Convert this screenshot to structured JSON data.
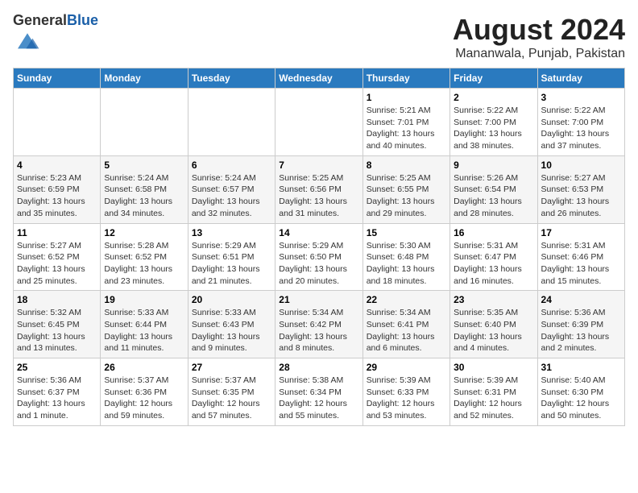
{
  "header": {
    "logo_general": "General",
    "logo_blue": "Blue",
    "month_title": "August 2024",
    "subtitle": "Mananwala, Punjab, Pakistan"
  },
  "days_of_week": [
    "Sunday",
    "Monday",
    "Tuesday",
    "Wednesday",
    "Thursday",
    "Friday",
    "Saturday"
  ],
  "weeks": [
    [
      {
        "day": "",
        "info": ""
      },
      {
        "day": "",
        "info": ""
      },
      {
        "day": "",
        "info": ""
      },
      {
        "day": "",
        "info": ""
      },
      {
        "day": "1",
        "info": "Sunrise: 5:21 AM\nSunset: 7:01 PM\nDaylight: 13 hours\nand 40 minutes."
      },
      {
        "day": "2",
        "info": "Sunrise: 5:22 AM\nSunset: 7:00 PM\nDaylight: 13 hours\nand 38 minutes."
      },
      {
        "day": "3",
        "info": "Sunrise: 5:22 AM\nSunset: 7:00 PM\nDaylight: 13 hours\nand 37 minutes."
      }
    ],
    [
      {
        "day": "4",
        "info": "Sunrise: 5:23 AM\nSunset: 6:59 PM\nDaylight: 13 hours\nand 35 minutes."
      },
      {
        "day": "5",
        "info": "Sunrise: 5:24 AM\nSunset: 6:58 PM\nDaylight: 13 hours\nand 34 minutes."
      },
      {
        "day": "6",
        "info": "Sunrise: 5:24 AM\nSunset: 6:57 PM\nDaylight: 13 hours\nand 32 minutes."
      },
      {
        "day": "7",
        "info": "Sunrise: 5:25 AM\nSunset: 6:56 PM\nDaylight: 13 hours\nand 31 minutes."
      },
      {
        "day": "8",
        "info": "Sunrise: 5:25 AM\nSunset: 6:55 PM\nDaylight: 13 hours\nand 29 minutes."
      },
      {
        "day": "9",
        "info": "Sunrise: 5:26 AM\nSunset: 6:54 PM\nDaylight: 13 hours\nand 28 minutes."
      },
      {
        "day": "10",
        "info": "Sunrise: 5:27 AM\nSunset: 6:53 PM\nDaylight: 13 hours\nand 26 minutes."
      }
    ],
    [
      {
        "day": "11",
        "info": "Sunrise: 5:27 AM\nSunset: 6:52 PM\nDaylight: 13 hours\nand 25 minutes."
      },
      {
        "day": "12",
        "info": "Sunrise: 5:28 AM\nSunset: 6:52 PM\nDaylight: 13 hours\nand 23 minutes."
      },
      {
        "day": "13",
        "info": "Sunrise: 5:29 AM\nSunset: 6:51 PM\nDaylight: 13 hours\nand 21 minutes."
      },
      {
        "day": "14",
        "info": "Sunrise: 5:29 AM\nSunset: 6:50 PM\nDaylight: 13 hours\nand 20 minutes."
      },
      {
        "day": "15",
        "info": "Sunrise: 5:30 AM\nSunset: 6:48 PM\nDaylight: 13 hours\nand 18 minutes."
      },
      {
        "day": "16",
        "info": "Sunrise: 5:31 AM\nSunset: 6:47 PM\nDaylight: 13 hours\nand 16 minutes."
      },
      {
        "day": "17",
        "info": "Sunrise: 5:31 AM\nSunset: 6:46 PM\nDaylight: 13 hours\nand 15 minutes."
      }
    ],
    [
      {
        "day": "18",
        "info": "Sunrise: 5:32 AM\nSunset: 6:45 PM\nDaylight: 13 hours\nand 13 minutes."
      },
      {
        "day": "19",
        "info": "Sunrise: 5:33 AM\nSunset: 6:44 PM\nDaylight: 13 hours\nand 11 minutes."
      },
      {
        "day": "20",
        "info": "Sunrise: 5:33 AM\nSunset: 6:43 PM\nDaylight: 13 hours\nand 9 minutes."
      },
      {
        "day": "21",
        "info": "Sunrise: 5:34 AM\nSunset: 6:42 PM\nDaylight: 13 hours\nand 8 minutes."
      },
      {
        "day": "22",
        "info": "Sunrise: 5:34 AM\nSunset: 6:41 PM\nDaylight: 13 hours\nand 6 minutes."
      },
      {
        "day": "23",
        "info": "Sunrise: 5:35 AM\nSunset: 6:40 PM\nDaylight: 13 hours\nand 4 minutes."
      },
      {
        "day": "24",
        "info": "Sunrise: 5:36 AM\nSunset: 6:39 PM\nDaylight: 13 hours\nand 2 minutes."
      }
    ],
    [
      {
        "day": "25",
        "info": "Sunrise: 5:36 AM\nSunset: 6:37 PM\nDaylight: 13 hours\nand 1 minute."
      },
      {
        "day": "26",
        "info": "Sunrise: 5:37 AM\nSunset: 6:36 PM\nDaylight: 12 hours\nand 59 minutes."
      },
      {
        "day": "27",
        "info": "Sunrise: 5:37 AM\nSunset: 6:35 PM\nDaylight: 12 hours\nand 57 minutes."
      },
      {
        "day": "28",
        "info": "Sunrise: 5:38 AM\nSunset: 6:34 PM\nDaylight: 12 hours\nand 55 minutes."
      },
      {
        "day": "29",
        "info": "Sunrise: 5:39 AM\nSunset: 6:33 PM\nDaylight: 12 hours\nand 53 minutes."
      },
      {
        "day": "30",
        "info": "Sunrise: 5:39 AM\nSunset: 6:31 PM\nDaylight: 12 hours\nand 52 minutes."
      },
      {
        "day": "31",
        "info": "Sunrise: 5:40 AM\nSunset: 6:30 PM\nDaylight: 12 hours\nand 50 minutes."
      }
    ]
  ]
}
